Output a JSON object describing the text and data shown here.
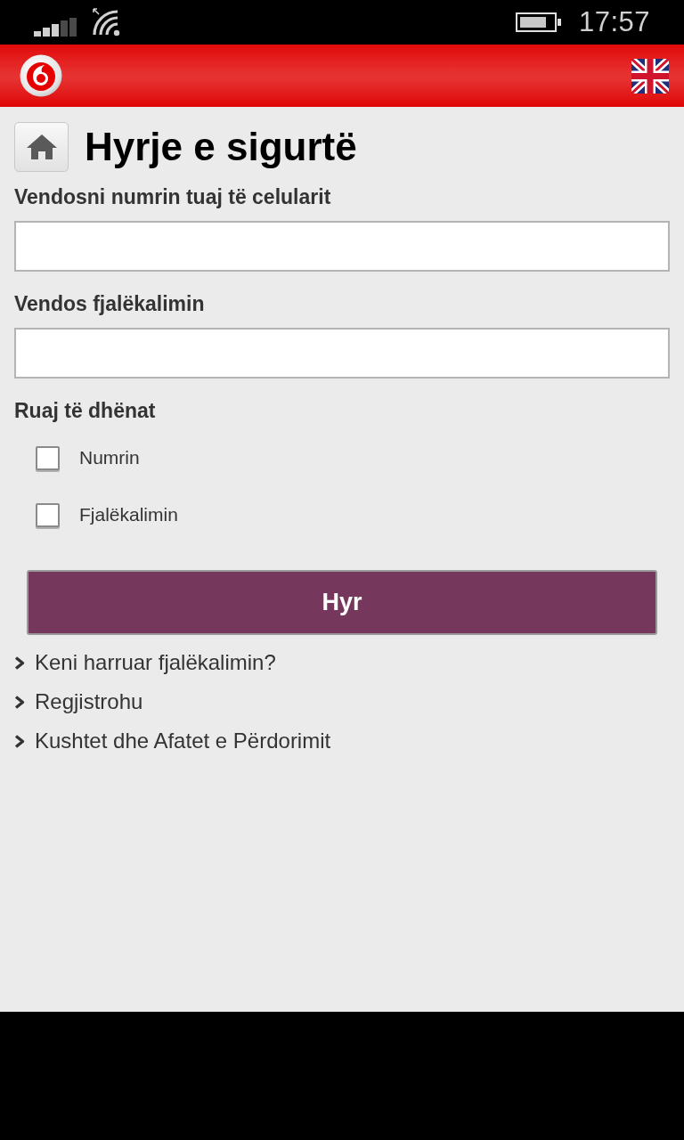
{
  "status_bar": {
    "time": "17:57"
  },
  "page": {
    "title": "Hyrje e sigurtë"
  },
  "fields": [
    {
      "label": "Vendosni numrin tuaj të celularit"
    },
    {
      "label": "Vendos fjalëkalimin"
    }
  ],
  "remember": {
    "label": "Ruaj të dhënat",
    "options": [
      {
        "label": "Numrin",
        "checked": false
      },
      {
        "label": "Fjalëkalimin",
        "checked": false
      }
    ]
  },
  "submit_button": {
    "label": "Hyr"
  },
  "links": [
    {
      "label": "Keni harruar fjalëkalimin?"
    },
    {
      "label": "Regjistrohu"
    },
    {
      "label": "Kushtet dhe Afatet e Përdorimit"
    }
  ]
}
